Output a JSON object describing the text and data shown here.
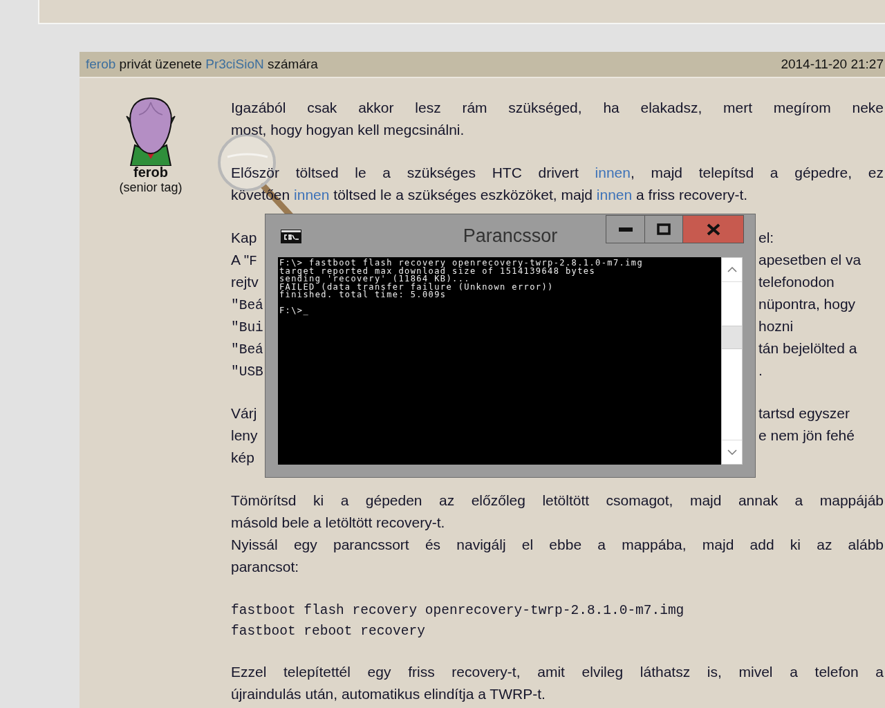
{
  "post": {
    "header": {
      "segments": [
        {
          "kind": "link",
          "text": "ferob"
        },
        {
          "kind": "text",
          "text": " privát üzenete "
        },
        {
          "kind": "link",
          "text": "Pr3ciSioN"
        },
        {
          "kind": "text",
          "text": " számára"
        }
      ],
      "date": "2014-11-20 21:27"
    },
    "author": {
      "name": "ferob",
      "rank": "(senior tag)"
    },
    "paragraphs": [
      {
        "kind": "text",
        "lines": [
          {
            "segments": [
              {
                "kind": "text",
                "text": "Igazából csak akkor lesz rám szükséged, ha elakadsz, mert megírom neke"
              }
            ]
          },
          {
            "segments": [
              {
                "kind": "text",
                "text": "most, hogy hogyan kell megcsinálni."
              }
            ]
          }
        ]
      },
      {
        "kind": "text",
        "lines": [
          {
            "segments": [
              {
                "kind": "text",
                "text": "Először töltsed le a szükséges HTC drivert "
              },
              {
                "kind": "link",
                "text": "innen"
              },
              {
                "kind": "text",
                "text": ", majd telepítsd a gépedre, ez"
              }
            ]
          },
          {
            "segments": [
              {
                "kind": "text",
                "text": "követően "
              },
              {
                "kind": "link",
                "text": "innen"
              },
              {
                "kind": "text",
                "text": " töltsed le a szükséges eszközöket, majd "
              },
              {
                "kind": "link",
                "text": "innen"
              },
              {
                "kind": "text",
                "text": " a friss recovery-t."
              }
            ]
          }
        ]
      },
      {
        "kind": "text",
        "lines": [
          {
            "segments": [
              {
                "kind": "text",
                "text": "Kap"
              }
            ],
            "right": [
              {
                "kind": "text",
                "text": "el:"
              }
            ]
          },
          {
            "segments": [
              {
                "kind": "text",
                "text": "A \""
              },
              {
                "kind": "code",
                "text": "F"
              }
            ],
            "right": [
              {
                "kind": "text",
                "text": "apesetben el va"
              }
            ]
          },
          {
            "segments": [
              {
                "kind": "text",
                "text": "rejtv"
              }
            ],
            "right": [
              {
                "kind": "text",
                "text": "telefonodon"
              }
            ]
          },
          {
            "segments": [
              {
                "kind": "code",
                "text": "\"Beá"
              }
            ],
            "right": [
              {
                "kind": "text",
                "text": "nüpontra, hogy"
              }
            ]
          },
          {
            "segments": [
              {
                "kind": "code",
                "text": "\"Bui"
              }
            ],
            "right": [
              {
                "kind": "text",
                "text": "hozni"
              }
            ]
          },
          {
            "segments": [
              {
                "kind": "code",
                "text": "\"Beá"
              }
            ],
            "right": [
              {
                "kind": "text",
                "text": "tán bejelölted a"
              }
            ]
          },
          {
            "segments": [
              {
                "kind": "code",
                "text": "\"USB"
              }
            ],
            "right": [
              {
                "kind": "text",
                "text": "."
              }
            ]
          }
        ]
      },
      {
        "kind": "text",
        "lines": [
          {
            "segments": [
              {
                "kind": "text",
                "text": "Várj"
              }
            ],
            "right": [
              {
                "kind": "text",
                "text": "tartsd egyszer"
              }
            ]
          },
          {
            "segments": [
              {
                "kind": "text",
                "text": "leny"
              }
            ],
            "right": [
              {
                "kind": "text",
                "text": "e nem jön fehé"
              }
            ]
          },
          {
            "segments": [
              {
                "kind": "text",
                "text": "kép"
              }
            ]
          }
        ]
      },
      {
        "kind": "text",
        "lines": [
          {
            "segments": [
              {
                "kind": "text",
                "text": "Tömörítsd ki a gépeden az előzőleg letöltött csomagot, majd annak a mappájáb"
              }
            ]
          },
          {
            "segments": [
              {
                "kind": "text",
                "text": "másold bele a letöltött recovery-t."
              }
            ],
            "hard_break": true
          },
          {
            "segments": [
              {
                "kind": "text",
                "text": "Nyissál egy parancssort és navigálj el ebbe a mappába, majd add ki az alább"
              }
            ]
          },
          {
            "segments": [
              {
                "kind": "text",
                "text": "parancsot:"
              }
            ]
          }
        ]
      },
      {
        "kind": "code",
        "lines": [
          {
            "segments": [
              {
                "kind": "code",
                "text": "fastboot flash recovery openrecovery-twrp-2.8.1.0-m7.img"
              }
            ]
          },
          {
            "segments": [
              {
                "kind": "code",
                "text": "fastboot reboot recovery"
              }
            ]
          }
        ]
      },
      {
        "kind": "text",
        "lines": [
          {
            "segments": [
              {
                "kind": "text",
                "text": "Ezzel telepítettél egy friss recovery-t, amit elvileg láthatsz is, mivel a telefon a"
              }
            ]
          },
          {
            "segments": [
              {
                "kind": "text",
                "text": "újraindulás után, automatikus elindítja a TWRP-t."
              }
            ]
          }
        ]
      }
    ]
  },
  "console_window": {
    "title": "Parancssor",
    "output": [
      "F:\\> fastboot flash recovery openrecovery-twrp-2.8.1.0-m7.img",
      "target reported max download size of 1514139648 bytes",
      "sending 'recovery' (11864 KB)...",
      "FAILED (data transfer failure (Unknown error))",
      "finished. total time: 5.009s"
    ],
    "prompt": "F:\\>_"
  }
}
